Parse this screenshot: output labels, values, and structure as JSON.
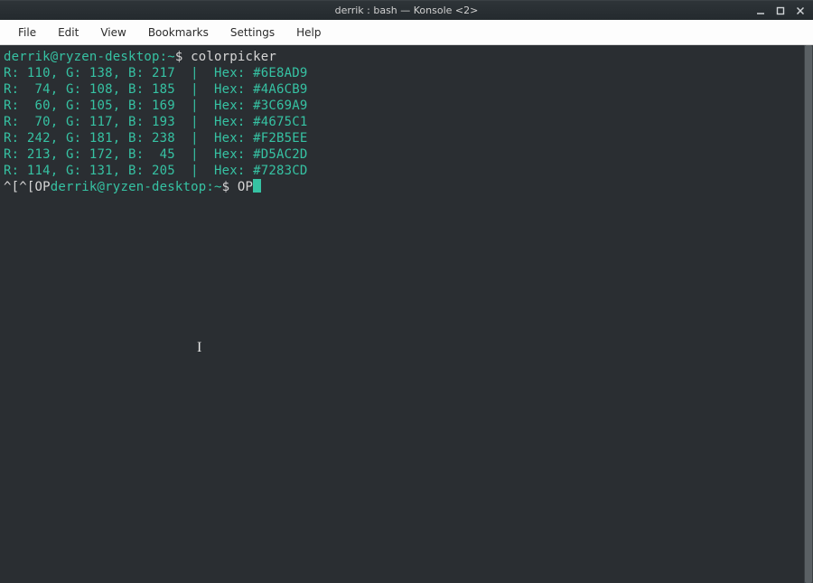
{
  "window": {
    "title": "derrik : bash — Konsole <2>"
  },
  "menus": {
    "file": "File",
    "edit": "Edit",
    "view": "View",
    "bookmarks": "Bookmarks",
    "settings": "Settings",
    "help": "Help"
  },
  "prompt": {
    "user_host": "derrik@ryzen-desktop",
    "cwd": "~",
    "sep": ":",
    "symbol": "$"
  },
  "command1": "colorpicker",
  "color_rows": [
    {
      "r": 110,
      "g": 138,
      "b": 217,
      "hex": "#6E8AD9"
    },
    {
      "r": 74,
      "g": 108,
      "b": 185,
      "hex": "#4A6CB9"
    },
    {
      "r": 60,
      "g": 105,
      "b": 169,
      "hex": "#3C69A9"
    },
    {
      "r": 70,
      "g": 117,
      "b": 193,
      "hex": "#4675C1"
    },
    {
      "r": 242,
      "g": 181,
      "b": 238,
      "hex": "#F2B5EE"
    },
    {
      "r": 213,
      "g": 172,
      "b": 45,
      "hex": "#D5AC2D"
    },
    {
      "r": 114,
      "g": 131,
      "b": 205,
      "hex": "#7283CD"
    }
  ],
  "trailing": {
    "preamble": "^[^[OP",
    "typed": "OP"
  }
}
